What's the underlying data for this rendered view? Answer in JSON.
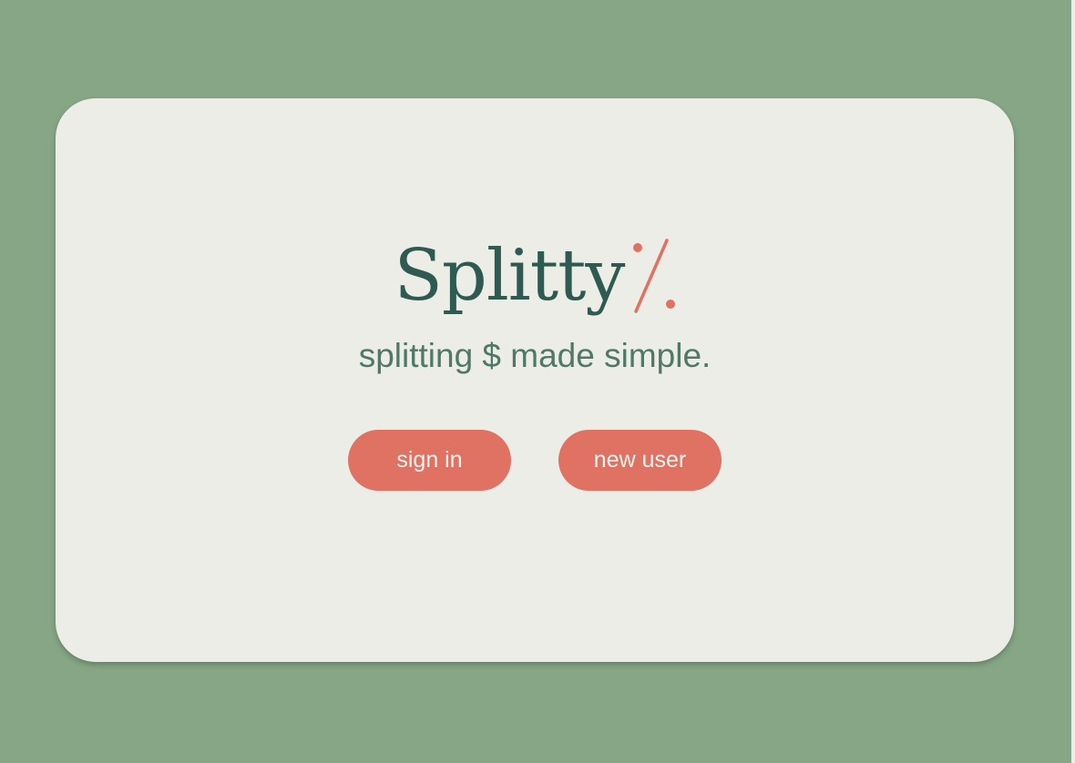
{
  "brand": {
    "name": "Splitty",
    "logo_mark_icon": "percent-icon",
    "tagline": "splitting $ made simple."
  },
  "actions": {
    "sign_in_label": "sign in",
    "new_user_label": "new user"
  },
  "colors": {
    "page_background": "#86a686",
    "card_background": "#ecede7",
    "brand_text": "#2e5a52",
    "tagline_text": "#4f7868",
    "accent": "#df7262",
    "button_text": "#f4f2ee"
  }
}
